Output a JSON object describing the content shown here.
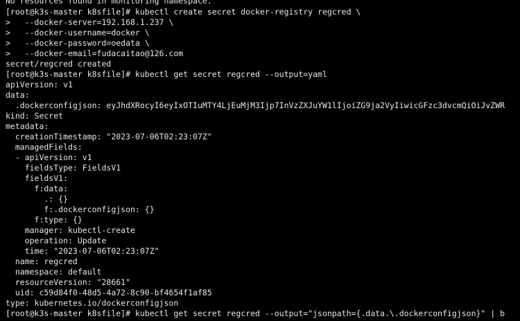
{
  "terminal": {
    "foreground": "#e8e8e8",
    "background": "#000000",
    "lines": [
      "No resources found in monitoring namespace.",
      "[root@k3s-master k8sfile]# kubectl create secret docker-registry regcred \\",
      ">   --docker-server=192.168.1.237 \\",
      ">   --docker-username=docker \\",
      ">   --docker-password=oedata \\",
      ">   --docker-email=fudacaitao@126.com",
      "secret/regcred created",
      "[root@k3s-master k8sfile]# kubectl get secret regcred --output=yaml",
      "apiVersion: v1",
      "data:",
      "  .dockerconfigjson: eyJhdXRocyI6eyIxOTIuMTY4LjEuMjM3Ijp7InVzZXJuYW1lIjoiZG9ja2VyIiwicGFzc3dvcmQiOiJvZWR",
      "kind: Secret",
      "metadata:",
      "  creationTimestamp: \"2023-07-06T02:23:07Z\"",
      "  managedFields:",
      "  - apiVersion: v1",
      "    fieldsType: FieldsV1",
      "    fieldsV1:",
      "      f:data:",
      "        .: {}",
      "        f:.dockerconfigjson: {}",
      "      f:type: {}",
      "    manager: kubectl-create",
      "    operation: Update",
      "    time: \"2023-07-06T02:23:07Z\"",
      "  name: regcred",
      "  namespace: default",
      "  resourceVersion: \"28661\"",
      "  uid: c59d84f0-48d5-4a72-8c90-bf4654f1af85",
      "type: kubernetes.io/dockerconfigjson",
      "[root@k3s-master k8sfile]# kubectl get secret regcred --output=\"jsonpath={.data.\\.dockerconfigjson}\" | b"
    ]
  }
}
